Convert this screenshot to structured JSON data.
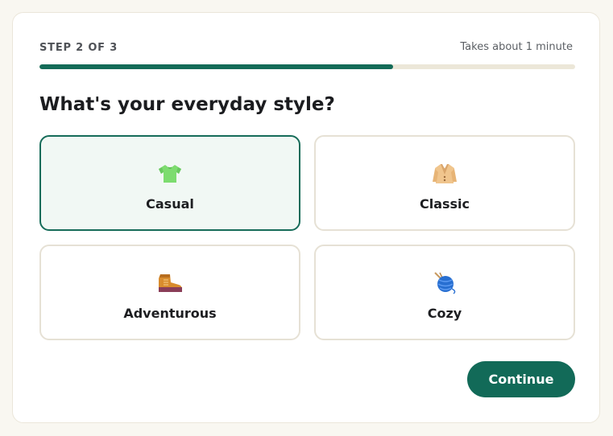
{
  "step": {
    "label": "STEP 2 OF 3",
    "duration": "Takes about 1 minute",
    "progress": 0.66
  },
  "question": "What's your everyday style?",
  "options": [
    {
      "label": "Casual",
      "icon": "t-shirt-icon",
      "selected": true
    },
    {
      "label": "Classic",
      "icon": "coat-icon",
      "selected": false
    },
    {
      "label": "Adventurous",
      "icon": "hiking-boot-icon",
      "selected": false
    },
    {
      "label": "Cozy",
      "icon": "yarn-ball-icon",
      "selected": false
    }
  ],
  "actions": {
    "continue_label": "Continue"
  },
  "colors": {
    "accent": "#126a58",
    "progress_track": "#ece7d8",
    "selected_background": "#f1f8f4",
    "page_background": "#f9f7f1"
  }
}
